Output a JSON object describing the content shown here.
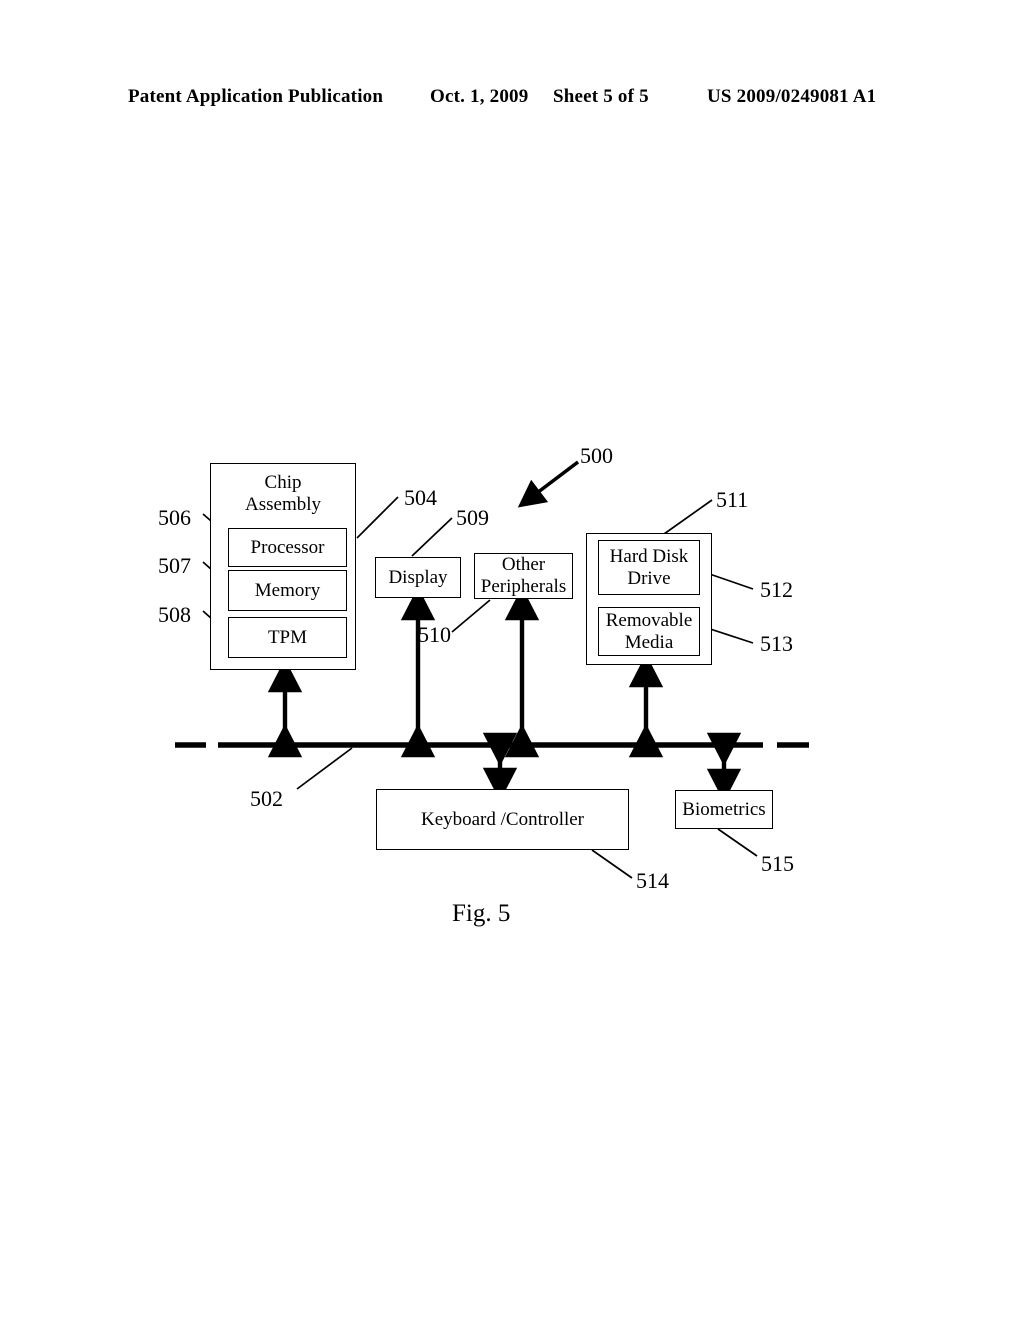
{
  "header": {
    "publication": "Patent Application Publication",
    "date": "Oct. 1, 2009",
    "sheet": "Sheet 5 of 5",
    "doc_number": "US 2009/0249081 A1"
  },
  "figure": {
    "caption": "Fig. 5",
    "system_ref": "500",
    "bus_ref": "502",
    "blocks": {
      "chip_assembly": {
        "label": "Chip\nAssembly",
        "line1": "Chip",
        "line2": "Assembly",
        "ref": "504"
      },
      "processor": {
        "label": "Processor",
        "ref": "506"
      },
      "memory": {
        "label": "Memory",
        "ref": "507"
      },
      "tpm": {
        "label": "TPM",
        "ref": "508"
      },
      "display": {
        "label": "Display",
        "ref": "509"
      },
      "other_peripherals": {
        "line1": "Other",
        "line2": "Peripherals",
        "ref": "510"
      },
      "storage_assembly": {
        "label": "",
        "ref": "511"
      },
      "hard_disk_drive": {
        "line1": "Hard Disk",
        "line2": "Drive",
        "ref": "512"
      },
      "removable_media": {
        "line1": "Removable",
        "line2": "Media",
        "ref": "513"
      },
      "keyboard_controller": {
        "label": "Keyboard /Controller",
        "ref": "514"
      },
      "biometrics": {
        "label": "Biometrics",
        "ref": "515"
      }
    }
  },
  "colors": {
    "ink": "#000000",
    "paper": "#ffffff"
  }
}
